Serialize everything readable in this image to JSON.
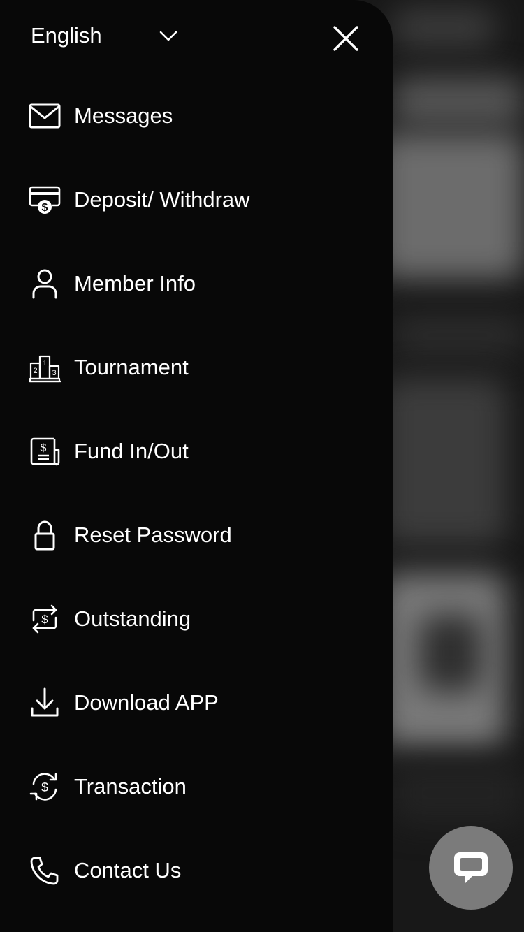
{
  "language": {
    "label": "English"
  },
  "menu": {
    "items": [
      {
        "label": "Messages",
        "icon": "mail-icon"
      },
      {
        "label": "Deposit/ Withdraw",
        "icon": "card-dollar-icon"
      },
      {
        "label": "Member Info",
        "icon": "user-icon"
      },
      {
        "label": "Tournament",
        "icon": "podium-icon"
      },
      {
        "label": "Fund In/Out",
        "icon": "receipt-dollar-icon"
      },
      {
        "label": "Reset Password",
        "icon": "lock-icon"
      },
      {
        "label": "Outstanding",
        "icon": "exchange-dollar-icon"
      },
      {
        "label": "Download APP",
        "icon": "download-icon"
      },
      {
        "label": "Transaction",
        "icon": "cycle-dollar-icon"
      },
      {
        "label": "Contact Us",
        "icon": "phone-icon"
      }
    ]
  },
  "colors": {
    "drawer_bg": "#080808",
    "text": "#ffffff",
    "chat_button": "#7b7b7b"
  }
}
